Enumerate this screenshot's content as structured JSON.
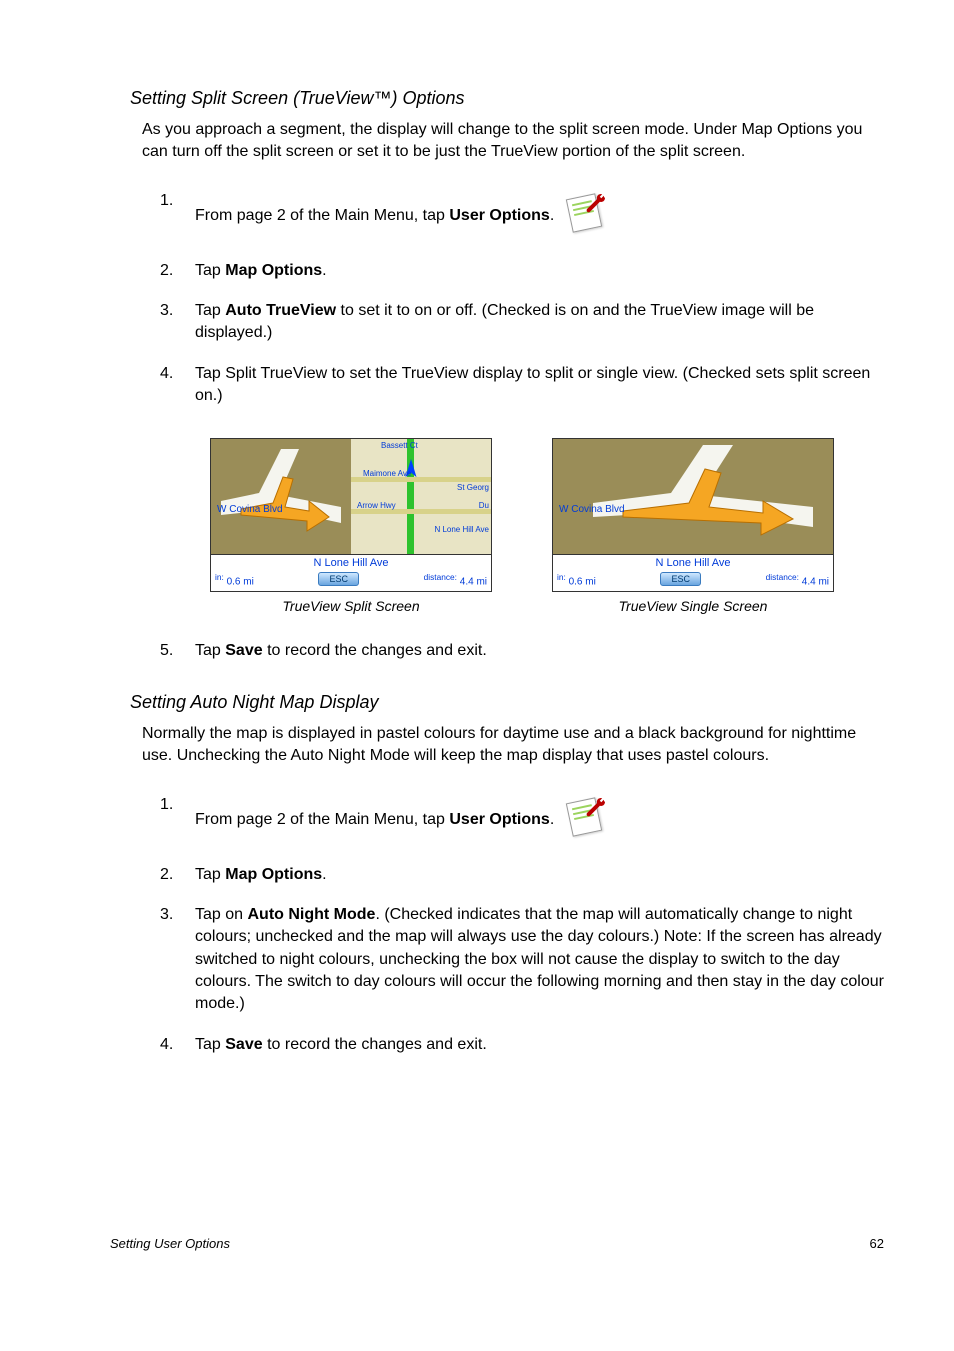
{
  "section1": {
    "title": "Setting Split Screen (TrueView™) Options",
    "intro": "As you approach a segment, the display will change to the split screen mode.  Under Map Options you can turn off the split screen or set it to be just the TrueView portion of the split screen.",
    "steps": {
      "s1_num": "1.",
      "s1_pre": "From page 2 of the Main Menu, tap ",
      "s1_bold": "User Options",
      "s1_post": ".",
      "s2_num": "2.",
      "s2_pre": "Tap ",
      "s2_bold": "Map Options",
      "s2_post": ".",
      "s3_num": "3.",
      "s3_pre": "Tap ",
      "s3_bold": "Auto TrueView",
      "s3_post": " to set it to on or off.  (Checked is on and the TrueView image will be displayed.)",
      "s4_num": "4.",
      "s4_text": "Tap Split TrueView to set the TrueView display to split or single view.  (Checked sets split screen on.)",
      "s5_num": "5.",
      "s5_pre": "Tap ",
      "s5_bold": "Save",
      "s5_post": " to record the changes and exit."
    },
    "figures": {
      "covina": "W Covina Blvd",
      "next_street": "N Lone Hill Ave",
      "in_label": "in:",
      "in_value": "0.6 mi",
      "esc": "ESC",
      "dist_label": "distance:",
      "dist_value": "4.4 mi",
      "caption_left": "TrueView Split Screen",
      "caption_right": "TrueView Single Screen",
      "map_labels": {
        "bassett": "Bassett Ct",
        "maimone": "Maimone Ave",
        "stgeorg": "St Georg",
        "arrow": "Arrow Hwy",
        "du": "Du",
        "lonehill": "N Lone Hill Ave"
      }
    }
  },
  "section2": {
    "title": "Setting Auto Night Map Display",
    "intro": "Normally the map is displayed in pastel colours for daytime use and a black background for nighttime use.  Unchecking the Auto Night Mode will keep the map display that uses pastel colours.",
    "steps": {
      "s1_num": "1.",
      "s1_pre": "From page 2 of the Main Menu, tap ",
      "s1_bold": "User Options",
      "s1_post": ".",
      "s2_num": "2.",
      "s2_pre": "Tap ",
      "s2_bold": "Map Options",
      "s2_post": ".",
      "s3_num": "3.",
      "s3_pre": "Tap on ",
      "s3_bold": "Auto Night Mode",
      "s3_post": ".  (Checked indicates that the map will automatically change to night colours; unchecked and the map will always use the day colours.)  Note: If the screen has already switched to night colours, unchecking the box will not cause the display to switch to the day colours.  The switch to day colours will occur the following morning and then stay in the day colour mode.)",
      "s4_num": "4.",
      "s4_pre": "Tap ",
      "s4_bold": "Save",
      "s4_post": " to record the changes and exit."
    }
  },
  "footer": {
    "left": "Setting User Options",
    "right": "62"
  }
}
